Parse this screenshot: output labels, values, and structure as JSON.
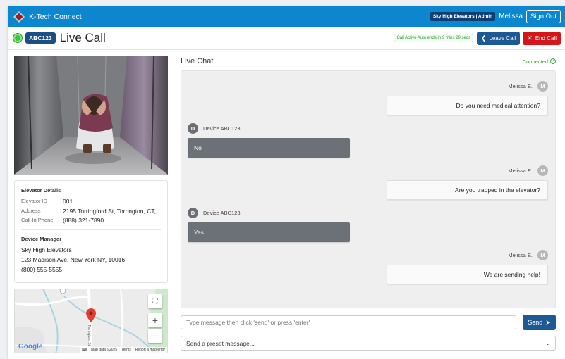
{
  "app": {
    "brand": "K-Tech Connect",
    "org_badge": "Sky High Elevators | Admin",
    "user": "Melissa",
    "signout_label": "Sign Out"
  },
  "call": {
    "device_badge": "ABC123",
    "title": "Live Call",
    "active_badge": "Call Active Auto ends in 9 mins 29 secs",
    "leave_label": "Leave Call",
    "end_label": "End Call"
  },
  "elevator": {
    "section_title": "Elevator Details",
    "fields": [
      {
        "label": "Elevator ID",
        "value": "001"
      },
      {
        "label": "Address",
        "value": "2195 Torringford St, Torrington, CT,"
      },
      {
        "label": "Call-In Phone",
        "value": "(888) 321-7890"
      }
    ]
  },
  "manager": {
    "section_title": "Device Manager",
    "name": "Sky High Elevators",
    "address": "123 Madison Ave, New York NY, 10016",
    "phone": "(800) 555-5555"
  },
  "map": {
    "street_label": "Torringford St",
    "google": "Google",
    "map_data": "Map data ©2025",
    "terms": "Terms",
    "report": "Report a map error"
  },
  "chat": {
    "title": "Live Chat",
    "status": "Connected",
    "messages": [
      {
        "from": "Melissa E.",
        "initial": "M",
        "text": "Do you need medical attention?"
      },
      {
        "from": "Device ABC123",
        "initial": "D",
        "text": "No"
      },
      {
        "from": "Melissa E.",
        "initial": "M",
        "text": "Are you trapped in the elevator?"
      },
      {
        "from": "Device ABC123",
        "initial": "D",
        "text": "Yes"
      },
      {
        "from": "Melissa E.",
        "initial": "M",
        "text": "We are sending help!"
      }
    ],
    "input_placeholder": "Type message then click 'send' or press 'enter'",
    "send_label": "Send",
    "preset_label": "Send a preset message..."
  },
  "colors": {
    "nav": "#0b86cf",
    "primary": "#1d5a95",
    "danger": "#d4161b",
    "online": "#37c837"
  }
}
